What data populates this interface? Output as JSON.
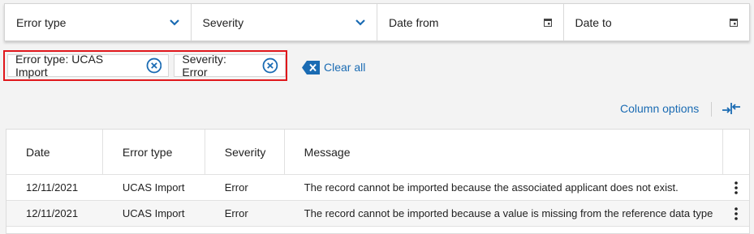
{
  "filters": [
    {
      "label": "Error type",
      "icon": "chevron-down-icon"
    },
    {
      "label": "Severity",
      "icon": "chevron-down-icon"
    },
    {
      "label": "Date from",
      "icon": "calendar-icon"
    },
    {
      "label": "Date to",
      "icon": "calendar-icon"
    }
  ],
  "active_filters": [
    {
      "label": "Error type: UCAS Import"
    },
    {
      "label": "Severity: Error"
    }
  ],
  "clear_all_label": "Clear all",
  "column_options_label": "Column options",
  "table": {
    "headers": [
      "Date",
      "Error type",
      "Severity",
      "Message"
    ],
    "rows": [
      {
        "date": "12/11/2021",
        "error_type": "UCAS Import",
        "severity": "Error",
        "message": "The record cannot be imported because the associated applicant does not exist."
      },
      {
        "date": "12/11/2021",
        "error_type": "UCAS Import",
        "severity": "Error",
        "message": "The record cannot be imported because a value is missing from the reference data type"
      }
    ]
  },
  "colors": {
    "accent": "#1a6bb3",
    "highlight_border": "#e0171b"
  }
}
